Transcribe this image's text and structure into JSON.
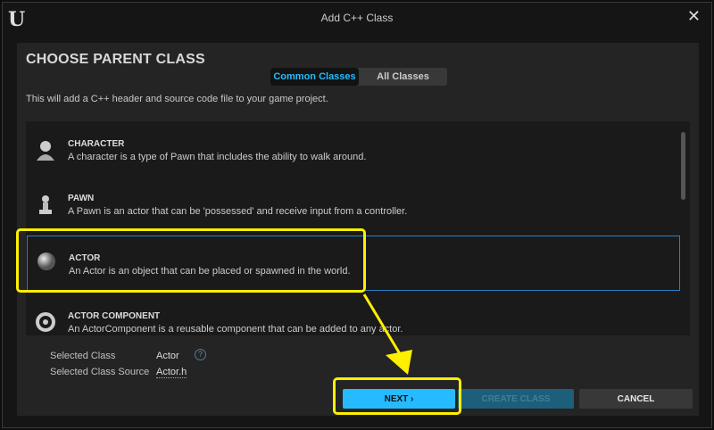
{
  "window": {
    "title": "Add C++ Class",
    "logo": "U"
  },
  "header": {
    "title": "CHOOSE PARENT CLASS",
    "description": "This will add a C++ header and source code file to your game project."
  },
  "tabs": [
    {
      "label": "Common Classes",
      "active": true
    },
    {
      "label": "All Classes",
      "active": false
    }
  ],
  "classes": [
    {
      "name": "CHARACTER",
      "description": "A character is a type of Pawn that includes the ability to walk around.",
      "icon": "character-icon"
    },
    {
      "name": "PAWN",
      "description": "A Pawn is an actor that can be 'possessed' and receive input from a controller.",
      "icon": "pawn-icon"
    },
    {
      "name": "ACTOR",
      "description": "An Actor is an object that can be placed or spawned in the world.",
      "icon": "actor-sphere-icon",
      "selected": true
    },
    {
      "name": "ACTOR COMPONENT",
      "description": "An ActorComponent is a reusable component that can be added to any actor.",
      "icon": "actor-component-icon"
    }
  ],
  "selection": {
    "class_label": "Selected Class",
    "class_value": "Actor",
    "source_label": "Selected Class Source",
    "source_value": "Actor.h",
    "help": "?"
  },
  "buttons": {
    "next": "NEXT ›",
    "create": "CREATE CLASS",
    "cancel": "CANCEL"
  },
  "colors": {
    "accent": "#26bbff",
    "highlight": "#ffef00"
  }
}
